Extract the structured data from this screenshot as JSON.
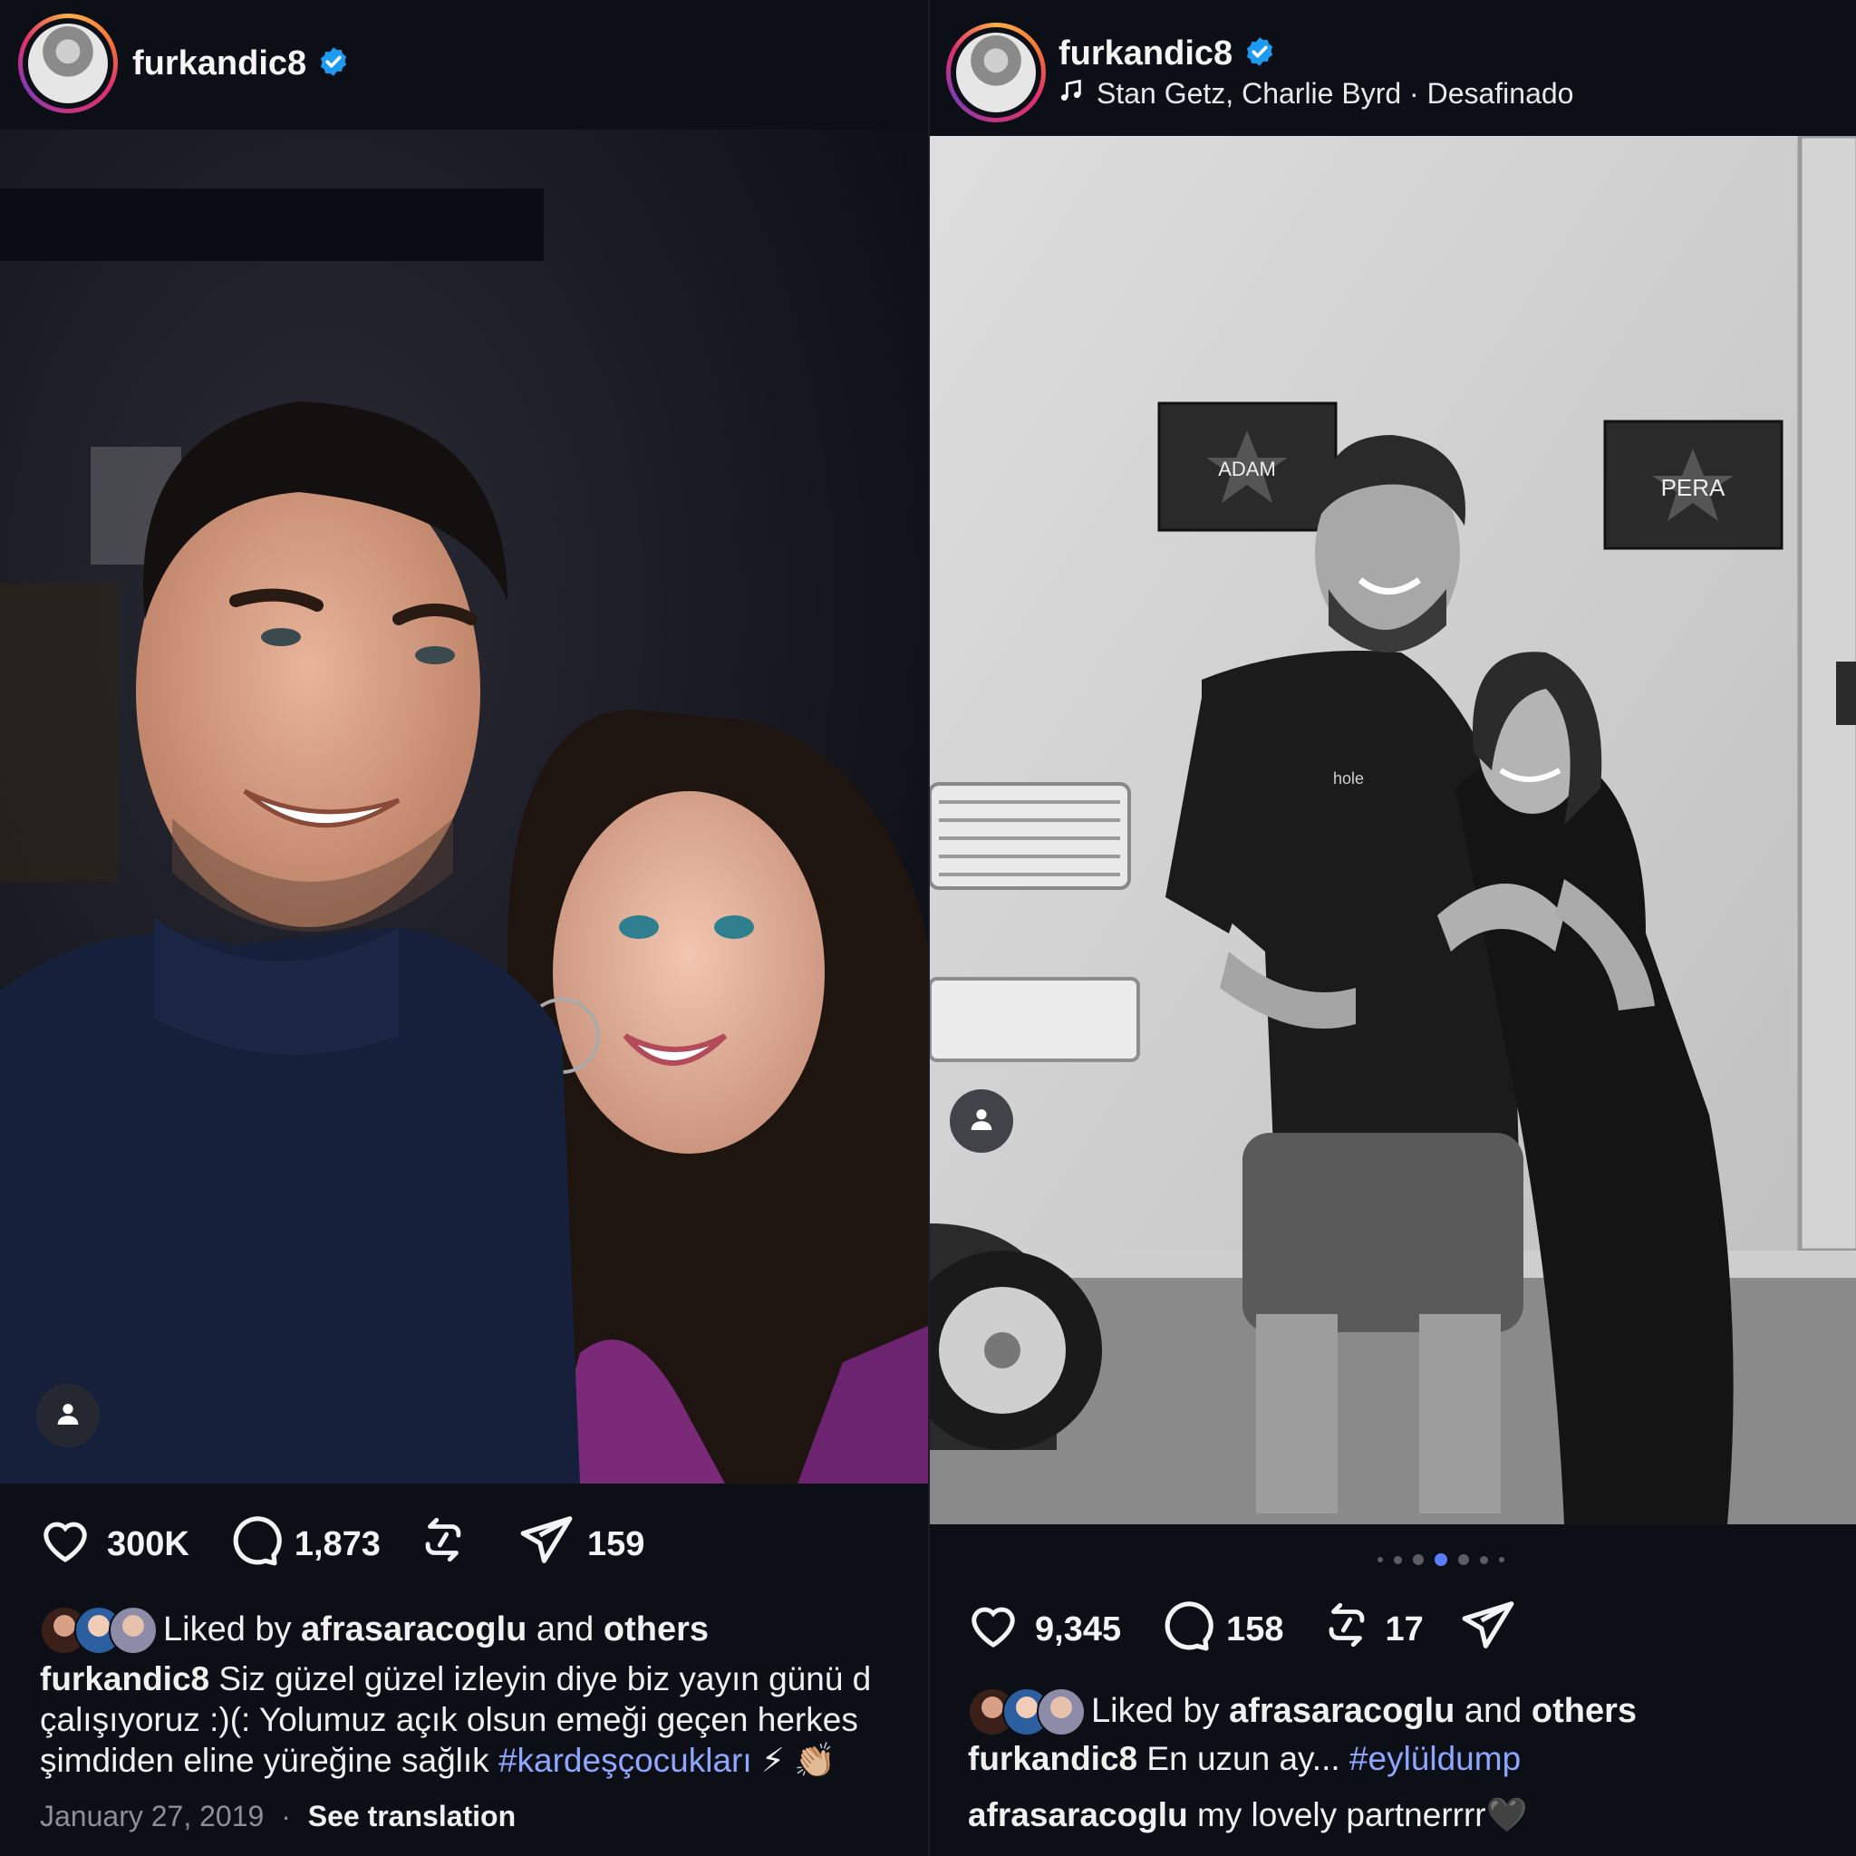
{
  "left_post": {
    "username": "furkandic8",
    "actions": {
      "likes": "300K",
      "comments": "1,873",
      "shares": "159"
    },
    "liked_by": {
      "prefix": "Liked by",
      "user": "afrasaracoglu",
      "and": "and",
      "others": "others"
    },
    "caption": {
      "user": "furkandic8",
      "line1": "Siz güzel güzel izleyin diye biz yayın günü d",
      "line2": "çalışıyoruz :)(: Yolumuz açık olsun emeği geçen herkes",
      "line3": "şimdiden eline yüreğine sağlık",
      "hashtag": "#kardeşçocukları",
      "emoji": "⚡ 👏🏼"
    },
    "date": "January 27, 2019",
    "separator": "·",
    "see_translation": "See translation"
  },
  "right_post": {
    "username": "furkandic8",
    "music": "Stan Getz, Charlie Byrd · Desafinado",
    "sign_left": "ADAM",
    "sign_right": "PERA",
    "shirt_text": "hole",
    "carousel": {
      "count": 7,
      "active": 3
    },
    "actions": {
      "likes": "9,345",
      "comments": "158",
      "reposts": "17"
    },
    "liked_by": {
      "prefix": "Liked by",
      "user": "afrasaracoglu",
      "and": "and",
      "others": "others"
    },
    "caption": {
      "user": "furkandic8",
      "text": "En uzun ay...",
      "hashtag": "#eylüldump"
    },
    "comment": {
      "user": "afrasaracoglu",
      "text": "my lovely partnerrrr🖤"
    }
  },
  "colors": {
    "background": "#0c0f16",
    "verified": "#1d9bf0",
    "hashtag": "#8fa6ff",
    "active_dot": "#5b7cff"
  },
  "icons": [
    "verified-badge-icon",
    "music-note-icon",
    "user-tag-icon",
    "heart-icon",
    "comment-icon",
    "repost-icon",
    "share-icon"
  ]
}
